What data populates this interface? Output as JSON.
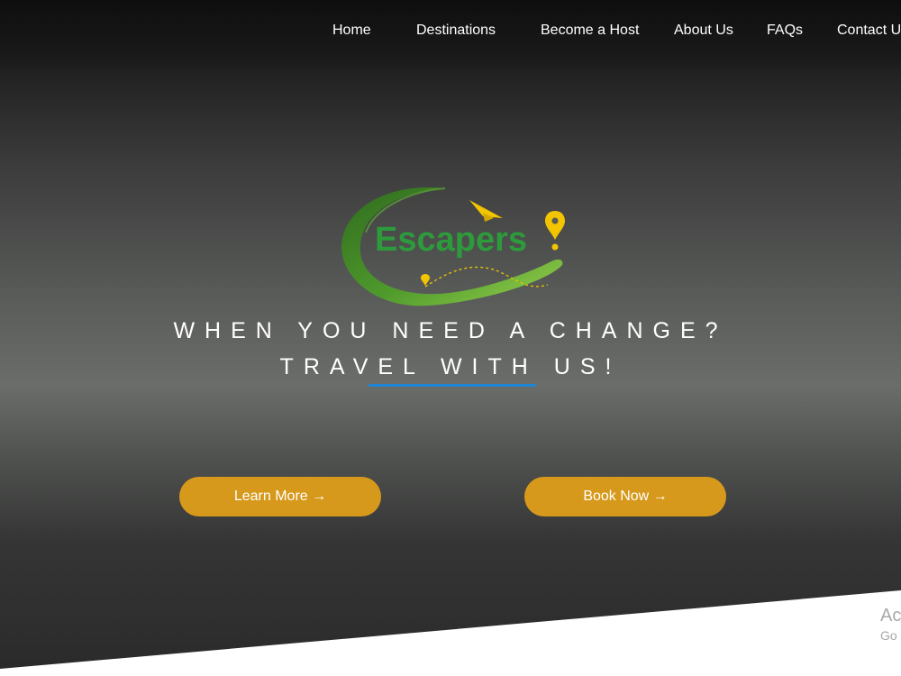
{
  "nav": {
    "items": [
      {
        "label": "Home"
      },
      {
        "label": "Destinations"
      },
      {
        "label": "Become a Host"
      },
      {
        "label": "About Us"
      },
      {
        "label": "FAQs"
      },
      {
        "label": "Contact U"
      }
    ]
  },
  "logo": {
    "text": "Escapers",
    "exclamation": "!",
    "icon": "map-pin-icon",
    "colors": {
      "text": "#2d9a3c",
      "swoosh_dark": "#2f6b1e",
      "swoosh_light": "#7dc142",
      "accent": "#f2c500"
    }
  },
  "hero": {
    "line1": "WHEN YOU NEED A CHANGE?",
    "line2": "TRAVEL WITH US!",
    "underline_color": "#1f86d6"
  },
  "buttons": {
    "learn_more": "Learn More →",
    "book_now": "Book Now →",
    "color": "#d7991c"
  },
  "watermark": {
    "line1": "Ac",
    "line2": "Go"
  }
}
